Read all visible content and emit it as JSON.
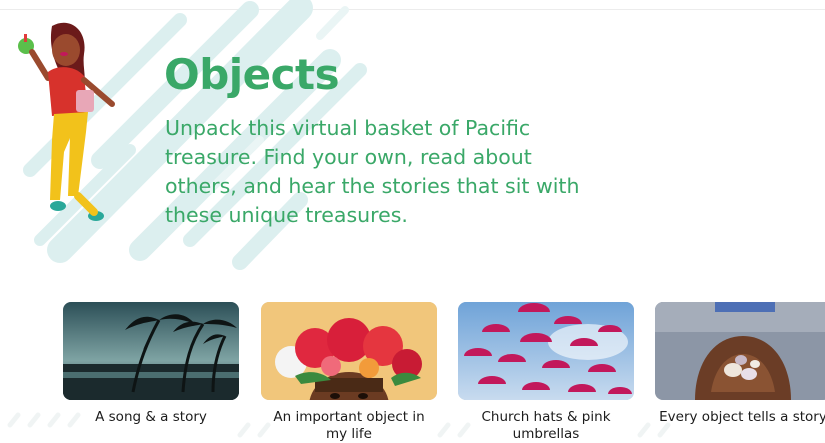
{
  "hero": {
    "title": "Objects",
    "description": "Unpack this virtual basket of Pacific treasure. Find your own, read about others, and hear the stories that sit with these unique treasures."
  },
  "cards": [
    {
      "caption": "A song & a story",
      "image": "palm-trees-sunset-photo"
    },
    {
      "caption": "An important object in my life",
      "image": "flower-crown-photo"
    },
    {
      "caption": "Church hats & pink umbrellas",
      "image": "pink-umbrellas-photo"
    },
    {
      "caption": "Every object tells a story",
      "image": "shells-in-hands-photo"
    }
  ],
  "colors": {
    "accent": "#3aa868",
    "streak": "#dff0f1",
    "text": "#1c1c1c"
  }
}
